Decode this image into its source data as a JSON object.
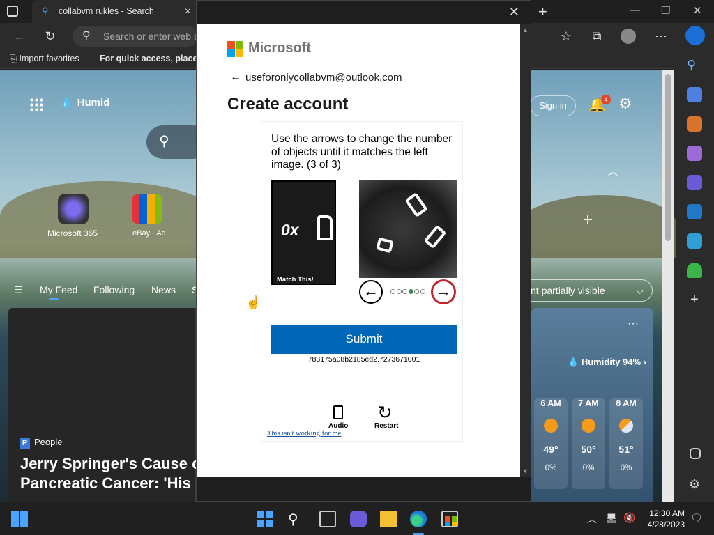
{
  "browser": {
    "tab_title": "collabvm rukles - Search",
    "address_placeholder": "Search or enter web a",
    "favorites": {
      "import": "Import favorites",
      "quick_access": "For quick access, place yo"
    }
  },
  "ntp": {
    "weather_label": "Humid",
    "tiles": [
      {
        "label": "Microsoft 365"
      },
      {
        "label": "eBay · Ad"
      }
    ],
    "sign_in": "Sign in",
    "notification_count": "4",
    "feed_tabs": [
      "My Feed",
      "Following",
      "News",
      "S"
    ],
    "content_pill": "nt partially visible",
    "news": {
      "source": "People",
      "headline_line1": "Jerry Springer's Cause c",
      "headline_line2": "Pancreatic Cancer: 'His Illness Was Sudden'"
    },
    "weather_card": {
      "more": "···",
      "humidity": "Humidity 94%",
      "hours": [
        {
          "time": "6 AM",
          "temp": "49°",
          "precip": "0%"
        },
        {
          "time": "7 AM",
          "temp": "50°",
          "precip": "0%"
        },
        {
          "time": "8 AM",
          "temp": "51°",
          "precip": "0%"
        }
      ]
    }
  },
  "dialog": {
    "brand": "Microsoft",
    "email": "useforonlycollabvm@outlook.com",
    "heading": "Create account",
    "captcha": {
      "instructions": "Use the arrows to change the number of objects until it matches the left image. (3 of 3)",
      "left_image_text": "0x",
      "match_label": "Match This!",
      "submit": "Submit",
      "token": "783175a08b2185ed2.7273671001",
      "audio": "Audio",
      "restart": "Restart",
      "not_working": "This isn't working for me",
      "dot_count": 6,
      "active_dot": 4
    }
  },
  "taskbar": {
    "time": "12:30 AM",
    "date": "4/28/2023"
  },
  "colors": {
    "ms_blue_button": "#0067b8",
    "ms_red": "#f25022",
    "ms_green": "#7fba00",
    "ms_blue": "#00a4ef",
    "ms_yellow": "#ffb900"
  }
}
